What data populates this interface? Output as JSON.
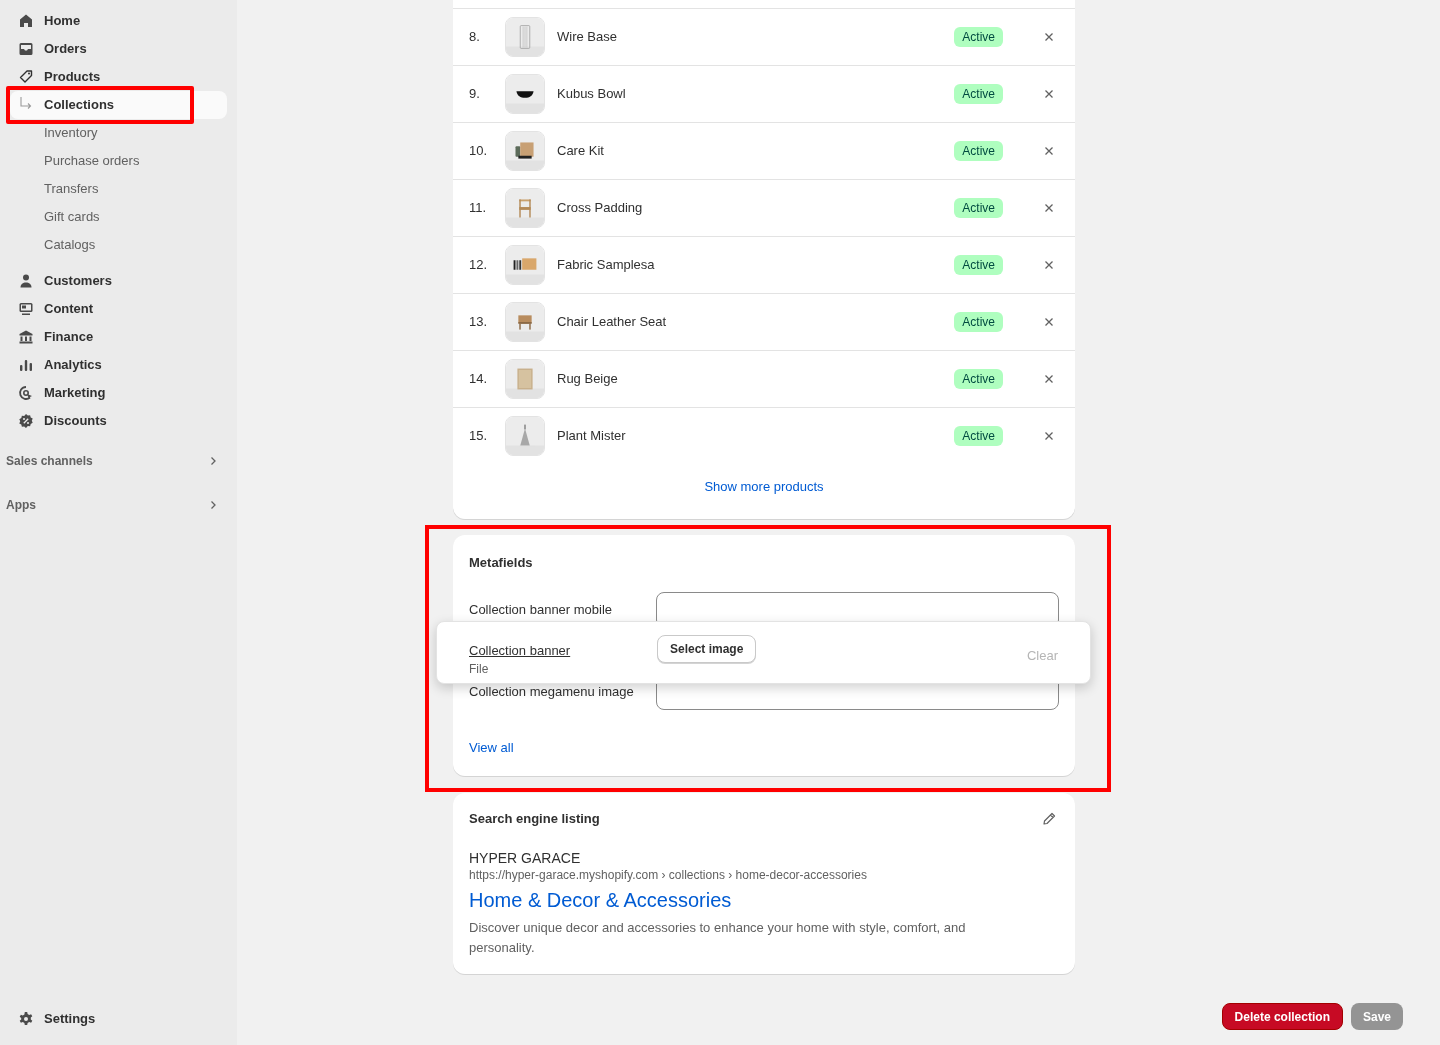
{
  "sidebar": {
    "items": [
      {
        "label": "Home",
        "kind": "main",
        "selected": false,
        "highlighted": false
      },
      {
        "label": "Orders",
        "kind": "main",
        "selected": false,
        "highlighted": false
      },
      {
        "label": "Products",
        "kind": "main",
        "selected": false,
        "highlighted": false
      },
      {
        "label": "Collections",
        "kind": "sub",
        "selected": true,
        "highlighted": true
      },
      {
        "label": "Inventory",
        "kind": "sub",
        "selected": false,
        "highlighted": false
      },
      {
        "label": "Purchase orders",
        "kind": "sub",
        "selected": false,
        "highlighted": false
      },
      {
        "label": "Transfers",
        "kind": "sub",
        "selected": false,
        "highlighted": false
      },
      {
        "label": "Gift cards",
        "kind": "sub",
        "selected": false,
        "highlighted": false
      },
      {
        "label": "Catalogs",
        "kind": "sub",
        "selected": false,
        "highlighted": false
      },
      {
        "label": "Customers",
        "kind": "main",
        "selected": false,
        "highlighted": false
      },
      {
        "label": "Content",
        "kind": "main",
        "selected": false,
        "highlighted": false
      },
      {
        "label": "Finance",
        "kind": "main",
        "selected": false,
        "highlighted": false
      },
      {
        "label": "Analytics",
        "kind": "main",
        "selected": false,
        "highlighted": false
      },
      {
        "label": "Marketing",
        "kind": "main",
        "selected": false,
        "highlighted": false
      },
      {
        "label": "Discounts",
        "kind": "main",
        "selected": false,
        "highlighted": false
      }
    ],
    "sections": [
      {
        "label": "Sales channels"
      },
      {
        "label": "Apps"
      }
    ],
    "settings": "Settings"
  },
  "products": {
    "rows": [
      {
        "index": "8.",
        "name": "Wire Base",
        "status": "Active"
      },
      {
        "index": "9.",
        "name": "Kubus Bowl",
        "status": "Active"
      },
      {
        "index": "10.",
        "name": "Care Kit",
        "status": "Active"
      },
      {
        "index": "11.",
        "name": "Cross Padding",
        "status": "Active"
      },
      {
        "index": "12.",
        "name": "Fabric Samplesa",
        "status": "Active"
      },
      {
        "index": "13.",
        "name": "Chair Leather Seat",
        "status": "Active"
      },
      {
        "index": "14.",
        "name": "Rug Beige",
        "status": "Active"
      },
      {
        "index": "15.",
        "name": "Plant Mister",
        "status": "Active"
      }
    ],
    "show_more": "Show more products"
  },
  "metafields": {
    "title": "Metafields",
    "highlighted": true,
    "fields": [
      {
        "label": "Collection banner mobile"
      },
      {
        "label": "Collection megamenu image"
      }
    ],
    "popover": {
      "label": "Collection banner",
      "type": "File",
      "button": "Select image",
      "clear": "Clear"
    },
    "view_all": "View all"
  },
  "seo": {
    "title": "Search engine listing",
    "store": "HYPER GARACE",
    "url": "https://hyper-garace.myshopify.com › collections › home-decor-accessories",
    "page_title": "Home & Decor & Accessories",
    "description": "Discover unique decor and accessories to enhance your home with style, comfort, and personality."
  },
  "actions": {
    "delete": "Delete collection",
    "save": "Save",
    "save_disabled": true
  }
}
